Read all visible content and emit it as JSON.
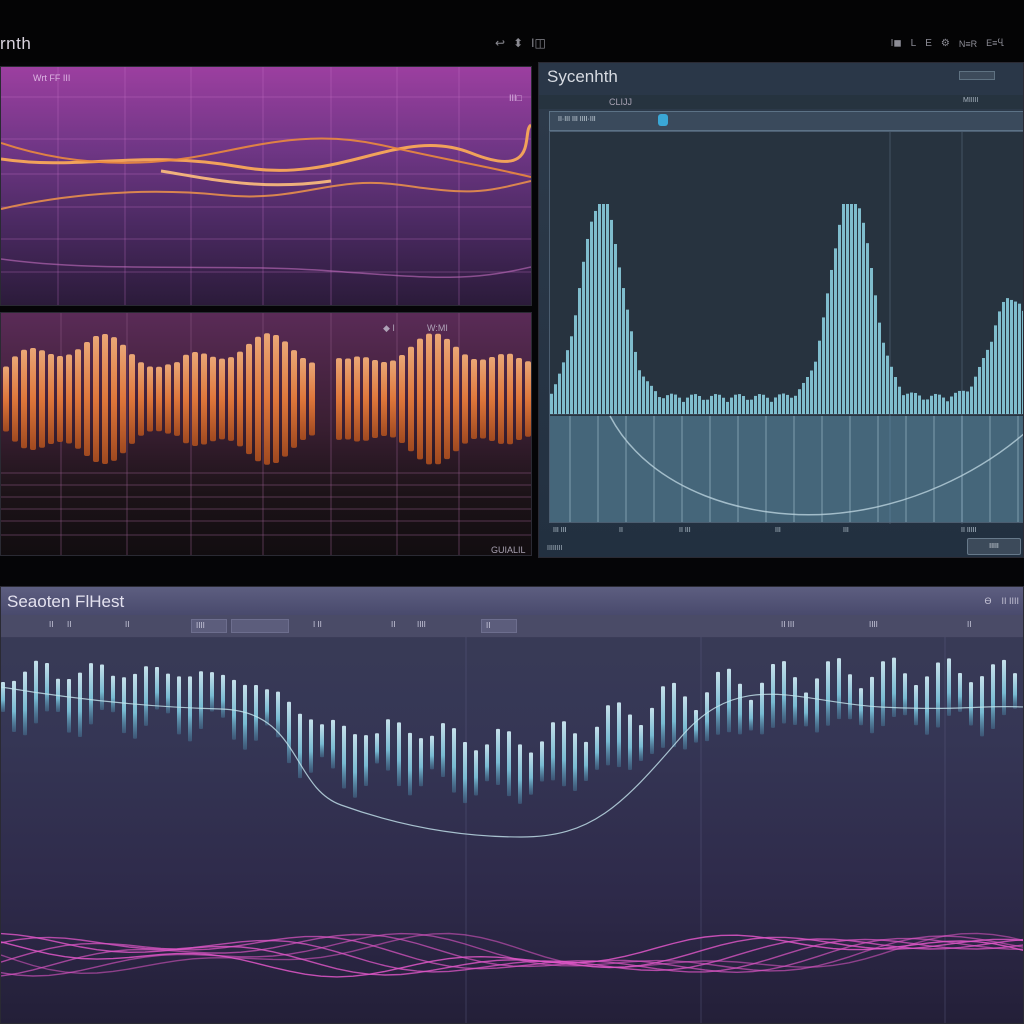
{
  "app": {
    "title": "rnth",
    "top_icons": [
      "↩",
      "⬍",
      "I◫"
    ],
    "top_right": [
      "I◼",
      "L",
      "E",
      "⚙",
      "N≡R",
      "E≡Ⴁ"
    ]
  },
  "panel_a": {
    "label_top": "Wrt FF ΙΙΙ",
    "label_right": "ΙΙΙ□"
  },
  "panel_b": {
    "label_controls": "◆ I",
    "label_field": "W:MI",
    "label_bottom": "GUIALIL"
  },
  "synth": {
    "title": "Sycenhth",
    "top_right": "▱▱",
    "sub_left": "CLIJJ",
    "sub_right": "ΜΙΙΙΙΙ",
    "toolbar_field": "ΙΙ·ΙΙΙ ΙΙΙ ΙΙΙΙ·ΙΙΙ ",
    "axis_labels": [
      "ΙΙΙ ΙΙΙ",
      "ΙΙ",
      "ΙΙ ΙΙΙ",
      "ΙΙΙ",
      "ΙΙΙ",
      "ΙΙ ΙΙΙΙΙ"
    ],
    "status": "ΙΙΙΙΙΙΙΙ",
    "button": "ΙΙΙΙΙ"
  },
  "filter": {
    "title": "Seaoten FlHest",
    "header_right": [
      "Ѳ",
      "ΙΙ ΙΙΙΙ"
    ],
    "toolbar": [
      "ΙΙ",
      "ΙΙ",
      "ΙΙ",
      "ΙΙΙΙ",
      "ΙΙ",
      "ΙΙΙΙ",
      "ΙΙ",
      "ΙΙ",
      "ΙΙΙΙ",
      "ΙΙΙ"
    ],
    "toolbar_labels": [
      "Ι ΙΙ",
      "ΙΙ ΙΙΙ",
      "ΙΙ",
      "ΙΙΙΙ",
      "ΙΙΙΙ",
      "ΙΙΙΙΙ",
      "Ι ΙΙ",
      "ΙΙ"
    ]
  },
  "colors": {
    "accent_orange": "#f08a3c",
    "accent_cyan": "#7fd3e6",
    "accent_pink": "#e055c8",
    "accent_purple": "#9c3fa0"
  }
}
